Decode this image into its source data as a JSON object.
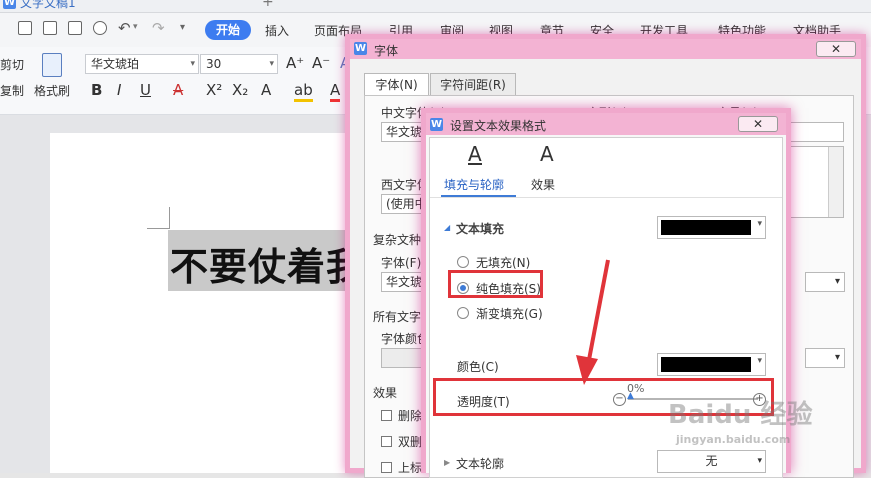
{
  "app": {
    "doc_title": "文字文稿1",
    "new_tab": "+"
  },
  "menu": {
    "active_tab": "开始",
    "tabs": [
      "插入",
      "页面布局",
      "引用",
      "审阅",
      "视图",
      "章节",
      "安全",
      "开发工具",
      "特色功能",
      "文档助手"
    ]
  },
  "toolbar": {
    "cut": "剪切",
    "copy": "复制",
    "format_painter": "格式刷",
    "font_name": "华文琥珀",
    "font_size": "30",
    "bold": "B",
    "italic": "I",
    "underline": "U",
    "strike": "A",
    "superscript": "X²",
    "subscript": "X₂",
    "grow": "A⁺",
    "shrink": "A⁻",
    "clear": "A",
    "highlight": "ab",
    "font_color": "A"
  },
  "document": {
    "text": "不要仗着我"
  },
  "font_dialog": {
    "title": "字体",
    "close": "✕",
    "tabs": [
      "字体(N)",
      "字符间距(R)"
    ],
    "chinese_font_label": "中文字体(T)",
    "style_label": "字形(Y)",
    "size_label": "字号(S)",
    "chinese_font_value": "华文琥珀",
    "western_font_label": "西文字体",
    "western_font_value": "(使用中文字体)",
    "complex_section": "复杂文种",
    "complex_font_label": "字体(F):",
    "complex_font_value": "华文琥珀",
    "all_text_section": "所有文字",
    "font_color_label": "字体颜色",
    "effects_section": "效果",
    "effects": [
      "删除线",
      "双删除线",
      "上标"
    ]
  },
  "effect_dialog": {
    "title": "设置文本效果格式",
    "close": "✕",
    "tabs": [
      "填充与轮廓",
      "效果"
    ],
    "text_fill": "文本填充",
    "options": [
      "无填充(N)",
      "纯色填充(S)",
      "渐变填充(G)"
    ],
    "selected_option": 1,
    "color_label": "颜色(C)",
    "transparency_label": "透明度(T)",
    "transparency_value": "0%",
    "text_outline": "文本轮廓",
    "outline_value": "无",
    "fill_color": "#000000"
  },
  "watermark": {
    "brand": "Baidu 经验",
    "url": "jingyan.baidu.com"
  }
}
